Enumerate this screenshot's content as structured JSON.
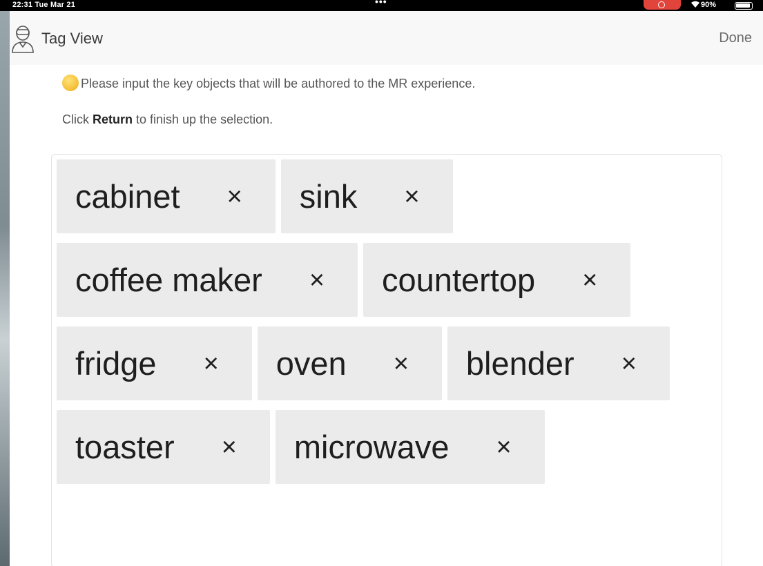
{
  "status_bar": {
    "time": "22:31  Tue Mar 21",
    "dots": "•••",
    "battery_pct": "90%"
  },
  "navbar": {
    "title": "Tag View",
    "done_label": "Done",
    "avatar_icon": "vr-headset-user-icon"
  },
  "instructions": {
    "line1_emoji": "thinking-face-emoji",
    "line1": "Please input the key objects that will be authored to the MR experience.",
    "line2_prefix": "Click ",
    "line2_bold": "Return",
    "line2_suffix": " to finish up the selection."
  },
  "tags": [
    {
      "label": "cabinet",
      "close": "×"
    },
    {
      "label": "sink",
      "close": "×"
    },
    {
      "label": "coffee maker",
      "close": "×"
    },
    {
      "label": "countertop",
      "close": "×"
    },
    {
      "label": "fridge",
      "close": "×"
    },
    {
      "label": "oven",
      "close": "×"
    },
    {
      "label": "blender",
      "close": "×"
    },
    {
      "label": "toaster",
      "close": "×"
    },
    {
      "label": "microwave",
      "close": "×"
    }
  ],
  "colors": {
    "tag_background": "#ebebeb",
    "record_indicator": "#e0443a"
  }
}
